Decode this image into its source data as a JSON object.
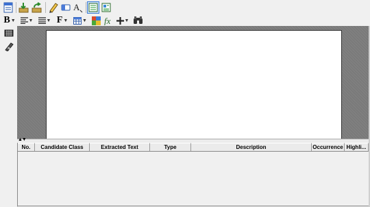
{
  "toolbar_row1": {
    "icons": [
      "page-setup-icon",
      "import-icon",
      "export-icon",
      "pen-icon",
      "eraser-icon",
      "text-format-icon",
      "split-view-icon",
      "layout-view-icon"
    ]
  },
  "toolbar_row2": {
    "bold_label": "B",
    "font_label": "F",
    "icons": [
      "bold-icon",
      "align-icon",
      "list-icon",
      "font-icon",
      "table-icon",
      "color-icon",
      "formula-icon",
      "insert-icon",
      "find-icon"
    ]
  },
  "grid": {
    "splitter_arrows": "▲▼",
    "columns": [
      "No.",
      "Candidate Class",
      "Extracted Text",
      "Type",
      "Description",
      "Occurrence",
      "Highli..."
    ]
  }
}
